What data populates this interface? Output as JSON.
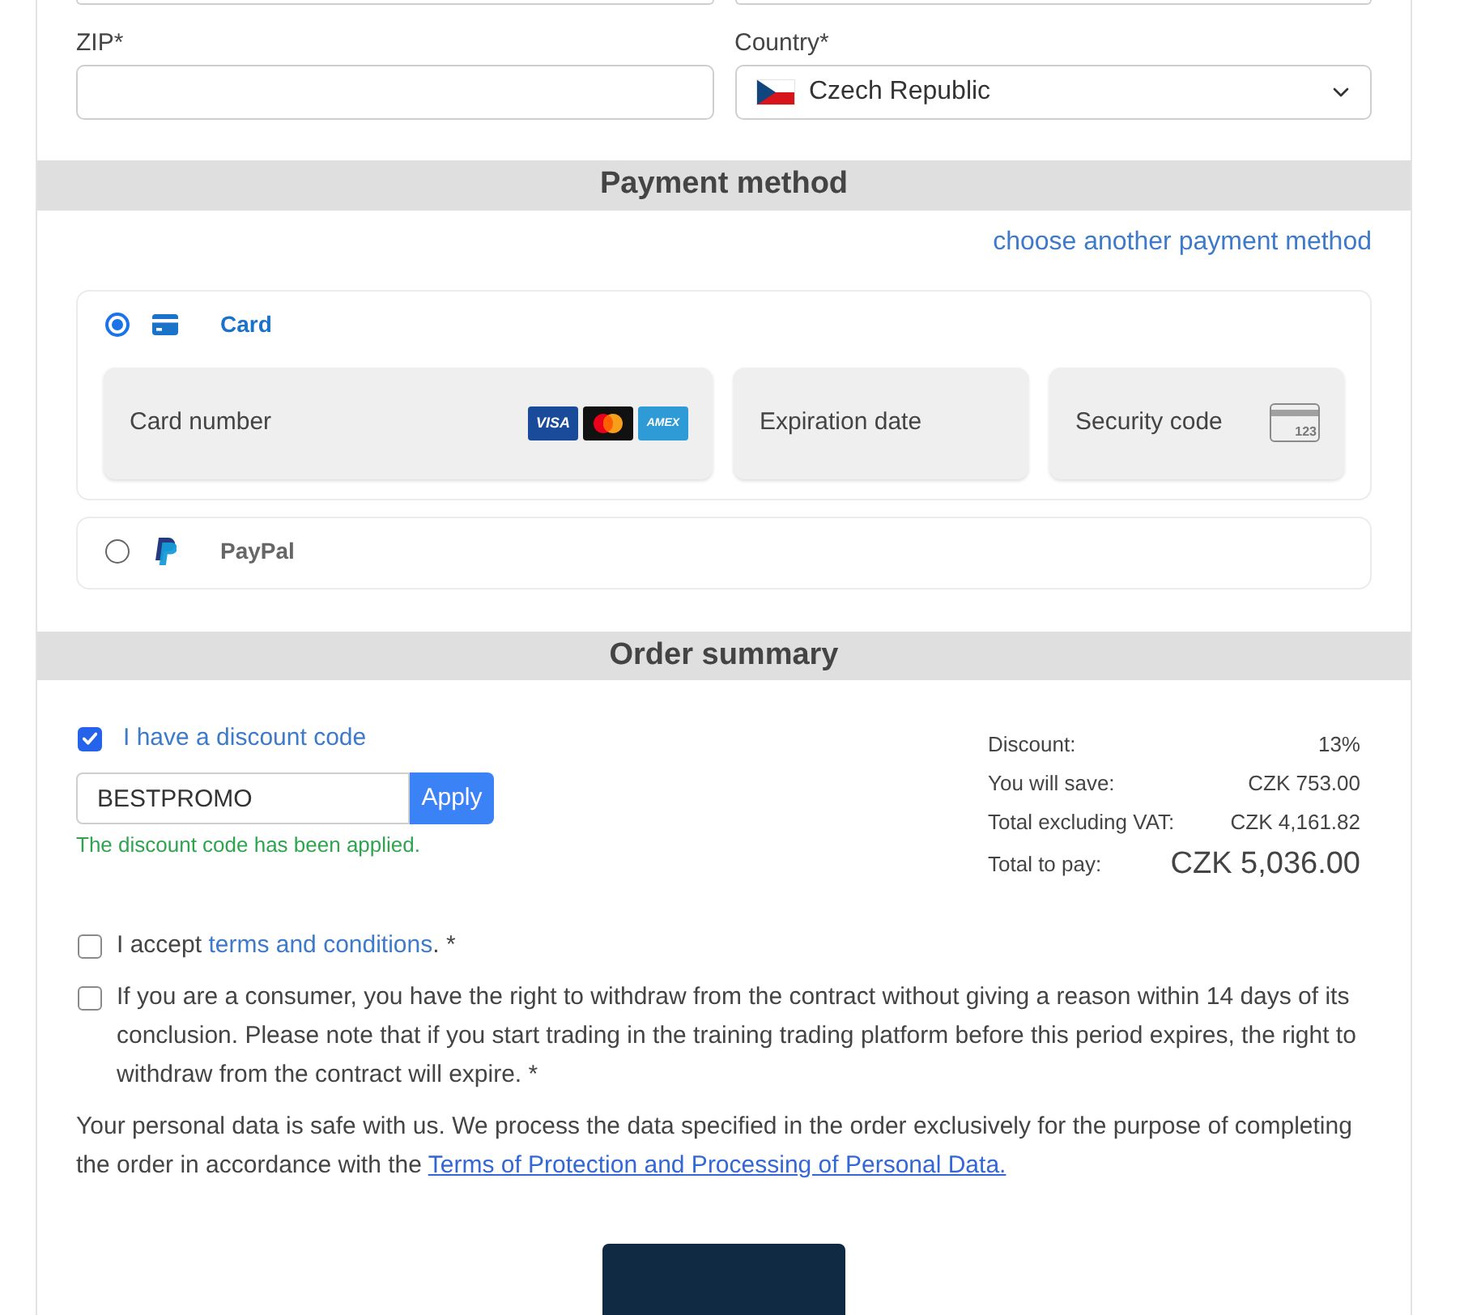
{
  "address": {
    "fields": [
      {
        "kind": "text",
        "label": "ZIP*"
      },
      {
        "kind": "select",
        "label": "Country*",
        "value": "Czech Republic"
      }
    ]
  },
  "payment": {
    "title": "Payment method",
    "change_link": "choose another payment method",
    "methods": [
      {
        "kind": "card",
        "label": "Card",
        "selected": true,
        "fields": [
          {
            "kind": "number",
            "placeholder": "Card number"
          },
          {
            "kind": "expiry",
            "placeholder": "Expiration date"
          },
          {
            "kind": "cvc",
            "placeholder": "Security code",
            "icon_text": "123"
          }
        ],
        "brands": [
          {
            "kind": "visa",
            "text": "VISA"
          },
          {
            "kind": "mastercard"
          },
          {
            "kind": "amex",
            "text": "AMEX"
          }
        ]
      },
      {
        "kind": "paypal",
        "label": "PayPal",
        "selected": false
      }
    ]
  },
  "order_summary": {
    "title": "Order summary",
    "discount": {
      "label": "I have a discount code",
      "checked": true,
      "value": "BESTPROMO",
      "button": "Apply",
      "message": "The discount code has been applied."
    },
    "totals": [
      {
        "kind": "line",
        "label": "Discount:",
        "value": "13%"
      },
      {
        "kind": "line",
        "label": "You will save:",
        "value": "CZK 753.00"
      },
      {
        "kind": "line",
        "label": "Total excluding VAT:",
        "value": "CZK 4,161.82"
      },
      {
        "kind": "total",
        "label": "Total to pay:",
        "value": "CZK 5,036.00"
      }
    ]
  },
  "consents": [
    {
      "checked": false,
      "parts": [
        {
          "kind": "text",
          "text": "I accept "
        },
        {
          "kind": "link",
          "text": "terms and conditions"
        },
        {
          "kind": "text",
          "text": ". *"
        }
      ]
    },
    {
      "checked": false,
      "parts": [
        {
          "kind": "text",
          "text": "If you are a consumer, you have the right to withdraw from the contract without giving a reason within 14 days of its conclusion. Please note that if you start trading in the training trading platform before this period expires, the right to withdraw from the contract will expire. *"
        }
      ]
    }
  ],
  "privacy_notice": {
    "parts": [
      {
        "kind": "text",
        "text": "Your personal data is safe with us. We process the data specified in the order exclusively for the purpose of completing the order in accordance with the "
      },
      {
        "kind": "link",
        "text": "Terms of Protection and Processing of Personal Data."
      }
    ]
  }
}
